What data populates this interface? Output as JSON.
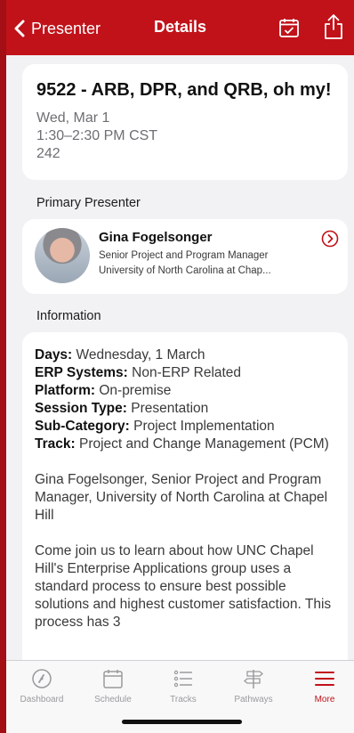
{
  "nav": {
    "back_label": "Presenter",
    "title": "Details"
  },
  "session": {
    "title": "9522 - ARB, DPR, and QRB, oh my!",
    "date": "Wed, Mar 1",
    "time": "1:30–2:30 PM CST",
    "room": "242"
  },
  "presenter_section": {
    "label": "Primary Presenter",
    "name": "Gina Fogelsonger",
    "role": "Senior Project and Program Manager",
    "org": "University of North Carolina at Chap..."
  },
  "info_section": {
    "label": "Information",
    "rows": [
      {
        "key": "Days:",
        "value": " Wednesday, 1 March"
      },
      {
        "key": "ERP Systems:",
        "value": " Non-ERP Related"
      },
      {
        "key": "Platform:",
        "value": " On-premise"
      },
      {
        "key": "Session Type:",
        "value": " Presentation"
      },
      {
        "key": "Sub-Category:",
        "value": " Project Implementation"
      },
      {
        "key": "Track:",
        "value": " Project and Change Management (PCM)"
      }
    ],
    "paragraph1": "Gina Fogelsonger, Senior Project and Program Manager, University of North Carolina at Chapel Hill",
    "paragraph2": "Come join us to learn about how UNC Chapel Hill's Enterprise Applications group uses a standard process to ensure best possible solutions and highest customer satisfaction.  This process has 3"
  },
  "tabs": [
    {
      "label": "Dashboard",
      "icon": "gauge-icon"
    },
    {
      "label": "Schedule",
      "icon": "calendar-icon"
    },
    {
      "label": "Tracks",
      "icon": "list-icon"
    },
    {
      "label": "Pathways",
      "icon": "signpost-icon"
    },
    {
      "label": "More",
      "icon": "menu-icon"
    }
  ],
  "colors": {
    "brand_red": "#c1121a",
    "background": "#f2f2f5"
  }
}
